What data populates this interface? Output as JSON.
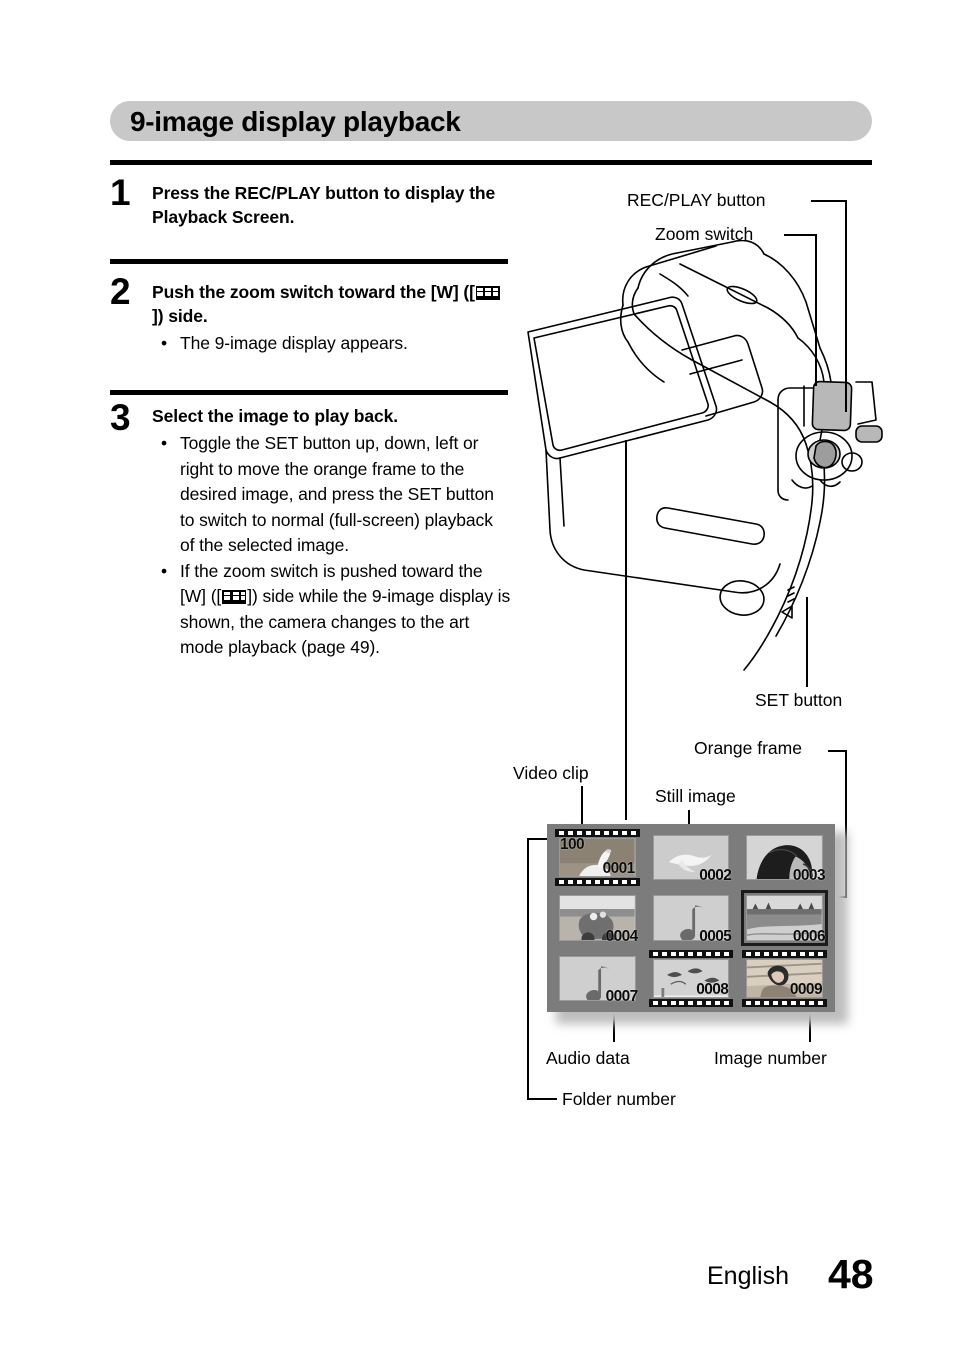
{
  "header": {
    "title": "9-image display playback"
  },
  "steps": [
    {
      "number": "1",
      "heading": "Press the REC/PLAY button to display the Playback Screen.",
      "bullets": []
    },
    {
      "number": "2",
      "heading_pre": "Push the zoom switch toward the [W] ([",
      "heading_post": "]) side.",
      "bullets": [
        {
          "text": "The 9-image display appears."
        }
      ]
    },
    {
      "number": "3",
      "heading": "Select the image to play back.",
      "bullets": [
        {
          "text": "Toggle the SET button up, down, left or right to move the orange frame to the desired image, and press the SET button to switch to normal (full-screen) playback of the selected image."
        },
        {
          "pre": "If the zoom switch is pushed toward the [W] ([",
          "post": "]) side while the 9-image display is shown, the camera changes to the art mode playback (page 49)."
        }
      ]
    }
  ],
  "callouts": {
    "rec_play_button": "REC/PLAY button",
    "zoom_switch": "Zoom switch",
    "set_button": "SET button",
    "orange_frame": "Orange frame",
    "video_clip": "Video clip",
    "still_image": "Still image",
    "audio_data": "Audio data",
    "image_number": "Image number",
    "folder_number": "Folder number"
  },
  "screen": {
    "folder_number": "100",
    "cells": [
      {
        "id": "0001",
        "type": "video",
        "subject": "bird-swan"
      },
      {
        "id": "0002",
        "type": "still",
        "subject": "seagull"
      },
      {
        "id": "0003",
        "type": "still",
        "subject": "portrait"
      },
      {
        "id": "0004",
        "type": "still",
        "subject": "flowers-cart"
      },
      {
        "id": "0005",
        "type": "audio",
        "subject": "audio-note"
      },
      {
        "id": "0006",
        "type": "still",
        "subject": "field",
        "selected": true
      },
      {
        "id": "0007",
        "type": "audio",
        "subject": "audio-note"
      },
      {
        "id": "0008",
        "type": "video",
        "subject": "birds-sky"
      },
      {
        "id": "0009",
        "type": "video",
        "subject": "child"
      }
    ],
    "audio_icon": "music-note-icon",
    "selection_color": "#ff7a00",
    "background_color": "#7c7c7c"
  },
  "footer": {
    "language": "English",
    "page": "48"
  }
}
